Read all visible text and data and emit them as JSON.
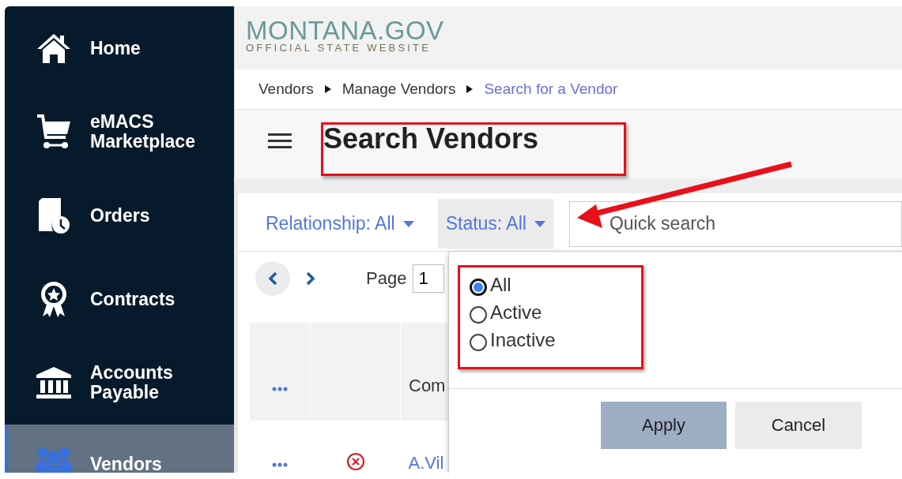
{
  "sidebar": {
    "items": [
      {
        "label": "Home",
        "kind": "home",
        "selected": false
      },
      {
        "label": "eMACS Marketplace",
        "kind": "cart",
        "selected": false
      },
      {
        "label": "Orders",
        "kind": "orders",
        "selected": false
      },
      {
        "label": "Contracts",
        "kind": "award",
        "selected": false
      },
      {
        "label": "Accounts Payable",
        "kind": "bank",
        "selected": false
      },
      {
        "label": "Vendors",
        "kind": "people",
        "selected": true
      }
    ]
  },
  "header": {
    "logo": "MONTANA.GOV",
    "tagline": "OFFICIAL STATE WEBSITE"
  },
  "breadcrumb": [
    {
      "label": "Vendors",
      "current": false
    },
    {
      "label": "Manage Vendors",
      "current": false
    },
    {
      "label": "Search for a Vendor",
      "current": true
    }
  ],
  "page_title": "Search Vendors",
  "filters": [
    {
      "label": "Relationship: All",
      "open": false
    },
    {
      "label": "Status: All",
      "open": true
    }
  ],
  "search": {
    "placeholder": "Quick search"
  },
  "pager": {
    "label": "Page",
    "value": "1"
  },
  "table": {
    "columns": [
      {
        "kind": "menu"
      },
      {
        "kind": "status"
      },
      {
        "kind": "text",
        "label": "Com"
      }
    ],
    "rows": [
      {
        "name": "A.Vil",
        "kind": "inactive"
      }
    ]
  },
  "status_menu": {
    "options": [
      {
        "label": "All",
        "selected": true
      },
      {
        "label": "Active",
        "selected": false
      },
      {
        "label": "Inactive",
        "selected": false
      }
    ],
    "buttons": [
      {
        "label": "Apply",
        "kind": "primary"
      },
      {
        "label": "Cancel",
        "kind": "secondary"
      }
    ]
  }
}
